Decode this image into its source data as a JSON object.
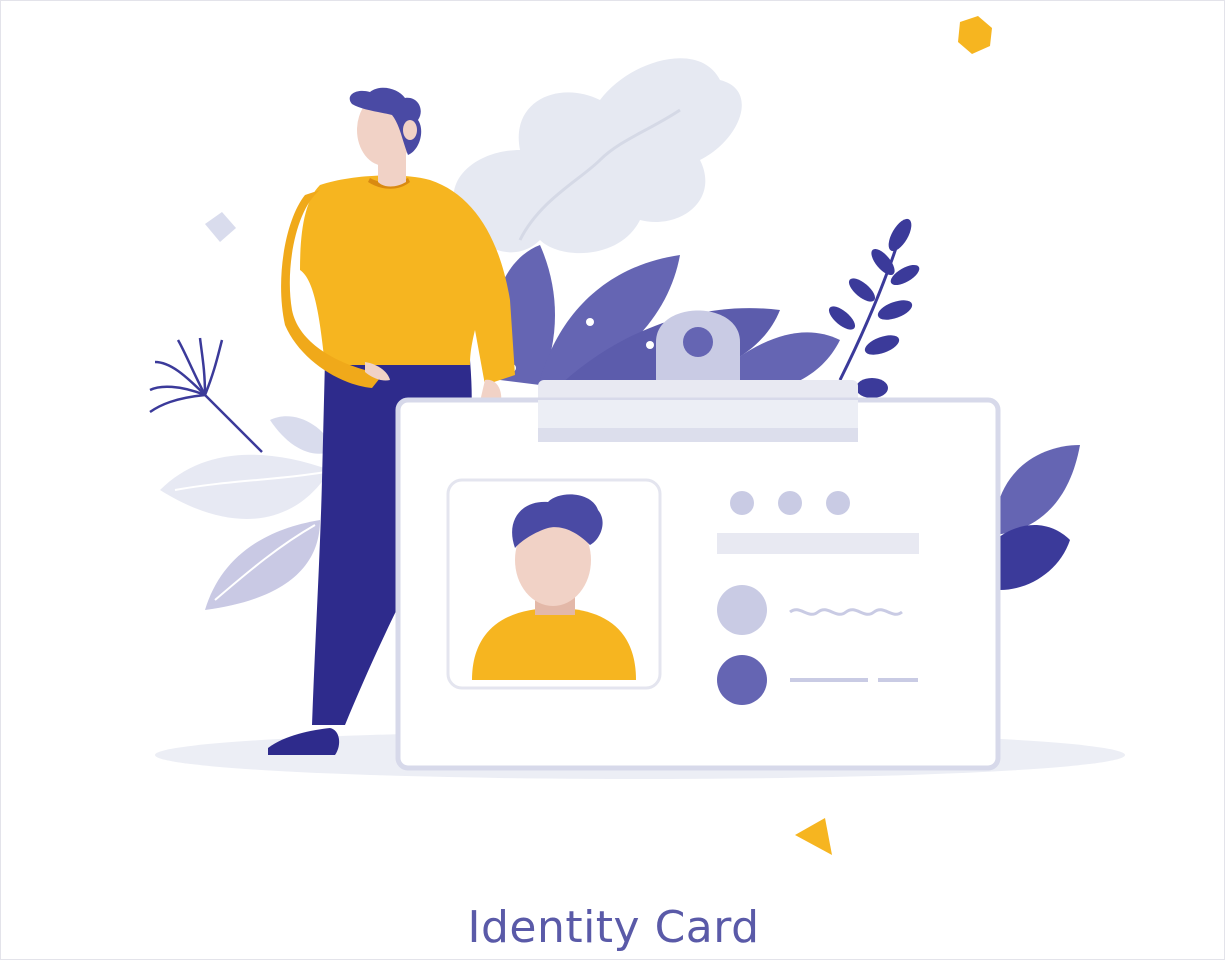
{
  "caption": "Identity Card",
  "colors": {
    "primary": "#5a5aa8",
    "navy": "#2e2b8c",
    "yellow": "#f6b520",
    "skin": "#f1d2c6",
    "lavender": "#c9c9e4",
    "pale": "#eceef5"
  },
  "icons": [
    "person-illustration",
    "id-card-illustration",
    "leaf-icon",
    "dandelion-icon",
    "hexagon-icon",
    "triangle-icon"
  ]
}
